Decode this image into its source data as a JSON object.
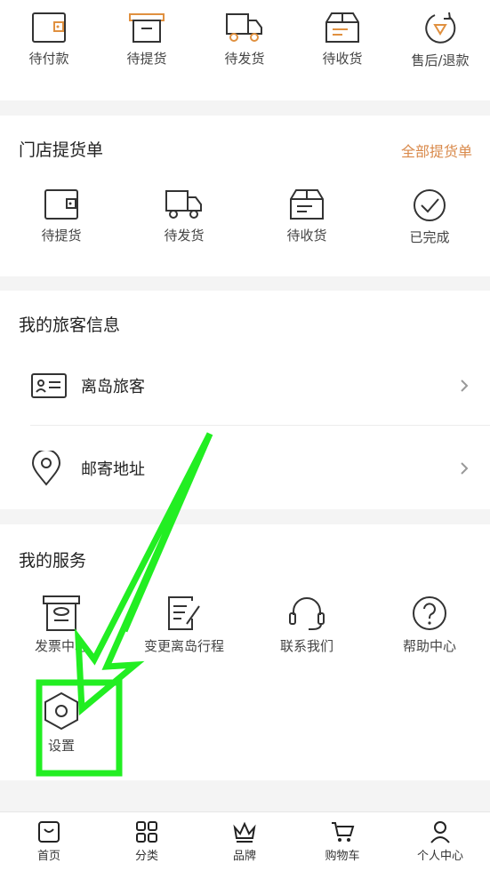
{
  "order_bar": {
    "items": [
      {
        "label": "待付款",
        "icon": "wallet-icon"
      },
      {
        "label": "待提货",
        "icon": "box-icon"
      },
      {
        "label": "待发货",
        "icon": "truck-icon"
      },
      {
        "label": "待收货",
        "icon": "package-icon"
      },
      {
        "label": "售后/退款",
        "icon": "refund-icon"
      }
    ]
  },
  "store_pickup": {
    "title": "门店提货单",
    "link": "全部提货单",
    "items": [
      {
        "label": "待提货",
        "icon": "wallet-icon"
      },
      {
        "label": "待发货",
        "icon": "truck-icon"
      },
      {
        "label": "待收货",
        "icon": "package-icon"
      },
      {
        "label": "已完成",
        "icon": "check-circle-icon"
      }
    ]
  },
  "traveler": {
    "title": "我的旅客信息",
    "rows": [
      {
        "label": "离岛旅客",
        "icon": "id-card-icon"
      },
      {
        "label": "邮寄地址",
        "icon": "location-pin-icon"
      }
    ]
  },
  "services": {
    "title": "我的服务",
    "items": [
      {
        "label": "发票中心",
        "icon": "invoice-icon"
      },
      {
        "label": "变更离岛行程",
        "icon": "edit-document-icon"
      },
      {
        "label": "联系我们",
        "icon": "headset-icon"
      },
      {
        "label": "帮助中心",
        "icon": "help-icon"
      },
      {
        "label": "设置",
        "icon": "settings-icon"
      }
    ]
  },
  "tabbar": {
    "items": [
      {
        "label": "首页",
        "icon": "home-bag-icon"
      },
      {
        "label": "分类",
        "icon": "grid-icon"
      },
      {
        "label": "品牌",
        "icon": "crown-icon"
      },
      {
        "label": "购物车",
        "icon": "cart-icon"
      },
      {
        "label": "个人中心",
        "icon": "user-icon"
      }
    ]
  },
  "colors": {
    "accent": "#d9894a",
    "annotation": "#22ee22",
    "background": "#f4f4f4"
  }
}
